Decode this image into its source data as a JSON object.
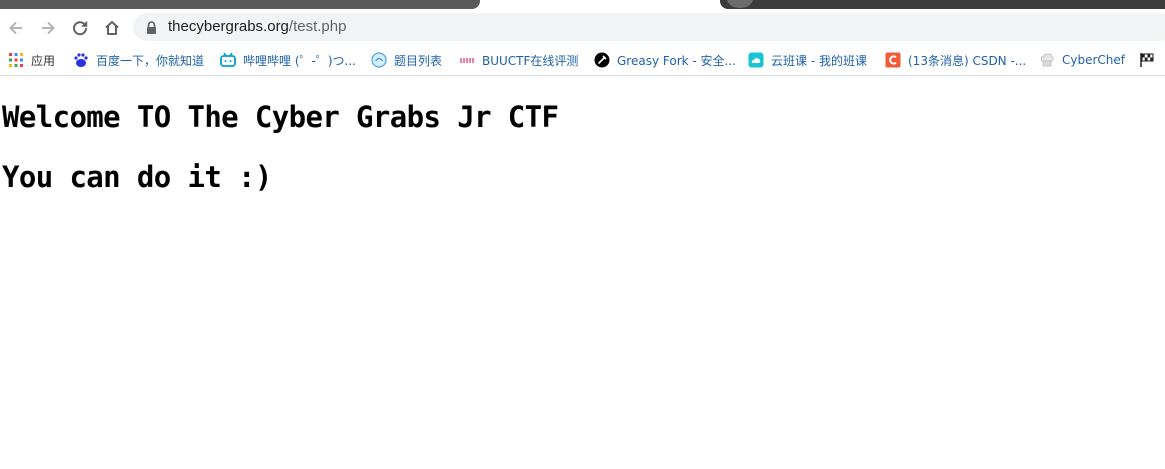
{
  "browser": {
    "url_domain": "thecybergrabs.org",
    "url_path": "/test.php"
  },
  "bookmarks": [
    {
      "label": "应用",
      "icon": "apps-grid-icon"
    },
    {
      "label": "百度一下，你就知道",
      "icon": "baidu-paw-icon"
    },
    {
      "label": "哔哩哔哩 (゜-゜)つ...",
      "icon": "bilibili-tv-icon"
    },
    {
      "label": "题目列表",
      "icon": "problem-list-icon"
    },
    {
      "label": "BUUCTF在线评测",
      "icon": "buuctf-icon"
    },
    {
      "label": "Greasy Fork - 安全...",
      "icon": "greasyfork-icon"
    },
    {
      "label": "云班课 - 我的班课",
      "icon": "cloud-class-icon"
    },
    {
      "label": "(13条消息) CSDN -...",
      "icon": "csdn-icon"
    },
    {
      "label": "CyberChef",
      "icon": "cyberchef-icon"
    },
    {
      "label": "",
      "icon": "checkered-flag-icon"
    }
  ],
  "page": {
    "heading_1": "Welcome TO The Cyber Grabs Jr CTF",
    "heading_2": "You can do it :)"
  },
  "colors": {
    "bookmark_text": "#1f61a8",
    "omnibox_bg": "#f1f3f4",
    "heading_text": "#000000"
  }
}
